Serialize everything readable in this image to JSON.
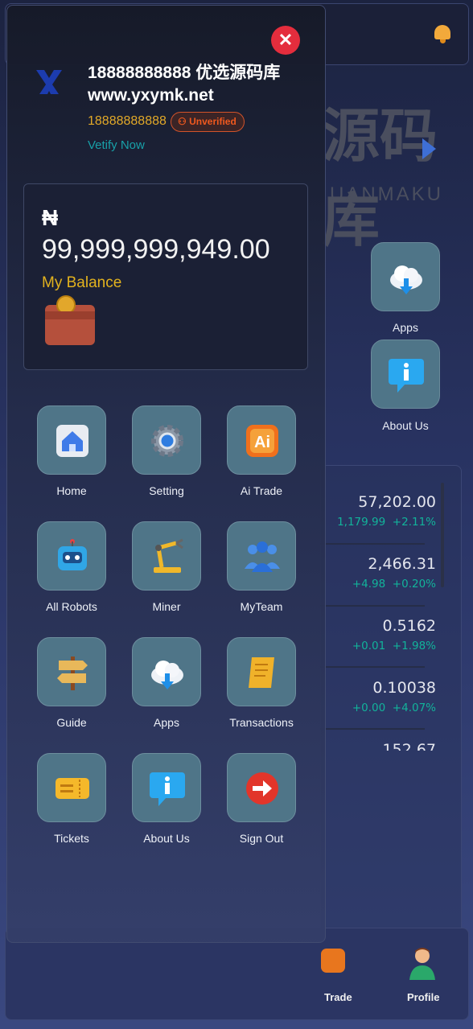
{
  "background": {
    "banner_text": "源码库",
    "banner_sub": "UANMAKU",
    "right_tiles": [
      {
        "label": "Apps",
        "icon": "cloud-download-icon"
      },
      {
        "label": "About Us",
        "icon": "info-icon"
      }
    ],
    "market": [
      {
        "price": "57,202.00",
        "change": "1,179.99",
        "percent": "+2.11%"
      },
      {
        "price": "2,466.31",
        "change": "+4.98",
        "percent": "+0.20%"
      },
      {
        "price": "0.5162",
        "change": "+0.01",
        "percent": "+1.98%"
      },
      {
        "price": "0.10038",
        "change": "+0.00",
        "percent": "+4.07%"
      },
      {
        "price": "152.67"
      }
    ],
    "bottom_nav": [
      {
        "label": "Trade",
        "icon": "ai-icon"
      },
      {
        "label": "Profile",
        "icon": "user-icon"
      }
    ]
  },
  "drawer": {
    "username": "18888888888 优选源码库",
    "site": "www.yxymk.net",
    "phone": "18888888888",
    "status_badge": "Unverified",
    "verify_link": "Vetify Now",
    "balance": {
      "currency": "₦",
      "amount": "99,999,999,949.00",
      "label": "My Balance"
    },
    "menu": [
      {
        "label": "Home",
        "icon": "home-icon"
      },
      {
        "label": "Setting",
        "icon": "gear-icon"
      },
      {
        "label": "Ai Trade",
        "icon": "ai-icon"
      },
      {
        "label": "All Robots",
        "icon": "robot-icon"
      },
      {
        "label": "Miner",
        "icon": "robot-arm-icon"
      },
      {
        "label": "MyTeam",
        "icon": "team-icon"
      },
      {
        "label": "Guide",
        "icon": "signpost-icon"
      },
      {
        "label": "Apps",
        "icon": "cloud-download-icon"
      },
      {
        "label": "Transactions",
        "icon": "scroll-icon"
      },
      {
        "label": "Tickets",
        "icon": "ticket-icon"
      },
      {
        "label": "About Us",
        "icon": "info-icon"
      },
      {
        "label": "Sign Out",
        "icon": "sign-out-icon"
      }
    ]
  },
  "colors": {
    "accent_gold": "#e2b21e",
    "positive": "#12b39a",
    "danger": "#e42d3d",
    "badge": "#f0591e",
    "link": "#18a0a8"
  }
}
